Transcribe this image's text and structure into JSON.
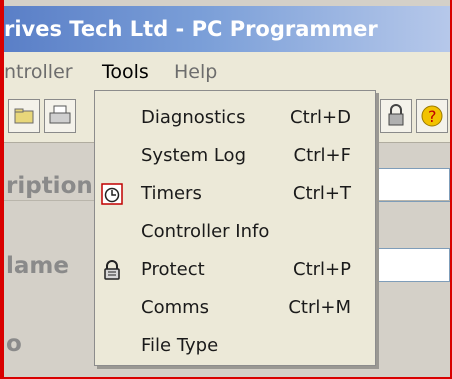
{
  "window": {
    "title": "rives Tech Ltd - PC Programmer"
  },
  "menubar": {
    "items": [
      {
        "label": "ntroller"
      },
      {
        "label": "Tools"
      },
      {
        "label": "Help"
      }
    ]
  },
  "background_labels": [
    "ription",
    "lame",
    "o"
  ],
  "tools_menu": {
    "items": [
      {
        "label": "Diagnostics",
        "shortcut": "Ctrl+D",
        "icon": ""
      },
      {
        "label": "System Log",
        "shortcut": "Ctrl+F",
        "icon": ""
      },
      {
        "label": "Timers",
        "shortcut": "Ctrl+T",
        "icon": "timer-icon"
      },
      {
        "label": "Controller Info",
        "shortcut": "",
        "icon": ""
      },
      {
        "label": "Protect",
        "shortcut": "Ctrl+P",
        "icon": "lock-icon"
      },
      {
        "label": "Comms",
        "shortcut": "Ctrl+M",
        "icon": ""
      },
      {
        "label": "File Type",
        "shortcut": "",
        "icon": ""
      }
    ]
  },
  "colors": {
    "titlebar": "#5a7fc7",
    "border_accent": "#d90000",
    "menu_bg": "#ece9d8"
  }
}
